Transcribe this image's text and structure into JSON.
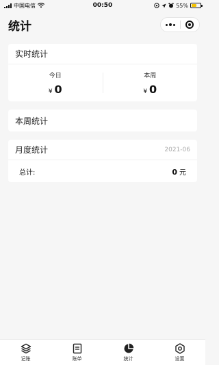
{
  "status_bar": {
    "carrier": "中国电信",
    "time": "00:50",
    "battery_percent": "55%",
    "battery_level": 0.55
  },
  "nav": {
    "title": "统计"
  },
  "realtime": {
    "title": "实时统计",
    "today_label": "今日",
    "today_currency": "¥",
    "today_value": "0",
    "week_label": "本周",
    "week_currency": "¥",
    "week_value": "0"
  },
  "weekly": {
    "title": "本周统计"
  },
  "monthly": {
    "title": "月度统计",
    "month": "2021-06",
    "total_label": "总计:",
    "total_value": "0",
    "total_unit": "元"
  },
  "tabs": [
    {
      "label": "记账",
      "icon": "layers-icon"
    },
    {
      "label": "账单",
      "icon": "bill-icon"
    },
    {
      "label": "统计",
      "icon": "pie-chart-icon"
    },
    {
      "label": "设置",
      "icon": "settings-icon"
    }
  ]
}
